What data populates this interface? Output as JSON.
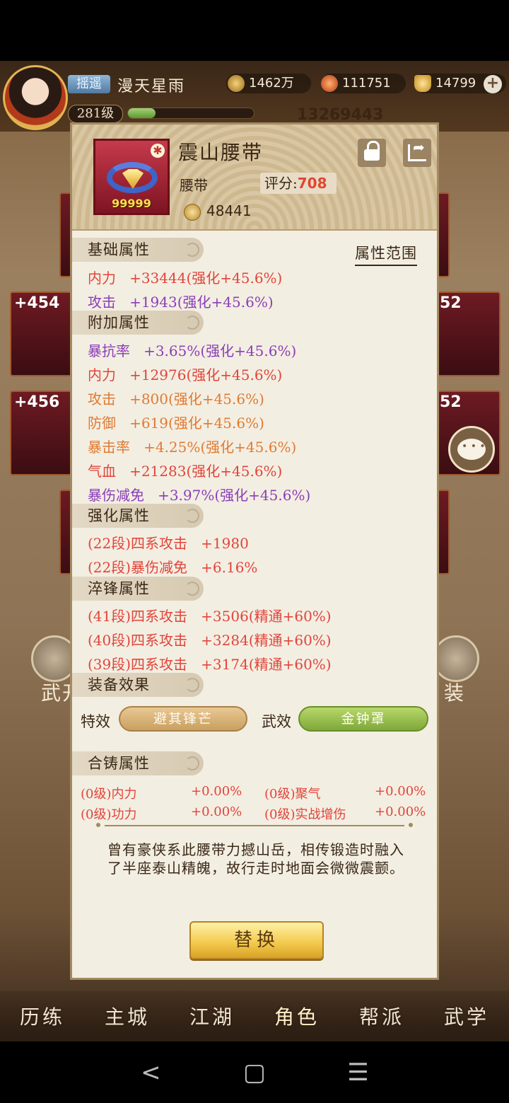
{
  "hud": {
    "title_badge": "摇遥",
    "player_name": "漫天星雨",
    "level": "281级",
    "exp_fraction": 0.22,
    "resources": {
      "coins": "1462万",
      "spirit": "111751",
      "gold": "14799"
    },
    "power": "13269443"
  },
  "background": {
    "slots": [
      "+454",
      "+456",
      "52",
      "52"
    ],
    "tabs": [
      "武开",
      "装"
    ]
  },
  "bottom_menu": [
    "历练",
    "主城",
    "江湖",
    "角色",
    "帮派",
    "武学"
  ],
  "nav_bar": {
    "back": "<",
    "home": "▢",
    "recents": "☰"
  },
  "item": {
    "name": "震山腰带",
    "type": "腰带",
    "score_label": "评分:",
    "score": "708",
    "quantity": "99999",
    "power": "48441"
  },
  "sections": {
    "base": "基础属性",
    "range_link": "属性范围",
    "extra": "附加属性",
    "enhance": "强化属性",
    "temper": "淬锋属性",
    "effects": "装备效果",
    "casting": "合铸属性"
  },
  "base_stats": [
    {
      "name": "内力",
      "value": "+33444(强化+45.6%)"
    },
    {
      "name": "攻击",
      "value": "+1943(强化+45.6%)"
    }
  ],
  "extra_stats": [
    {
      "name": "暴抗率",
      "value": "+3.65%(强化+45.6%)"
    },
    {
      "name": "内力",
      "value": "+12976(强化+45.6%)"
    },
    {
      "name": "攻击",
      "value": "+800(强化+45.6%)"
    },
    {
      "name": "防御",
      "value": "+619(强化+45.6%)"
    },
    {
      "name": "暴击率",
      "value": "+4.25%(强化+45.6%)"
    },
    {
      "name": "气血",
      "value": "+21283(强化+45.6%)"
    },
    {
      "name": "暴伤减免",
      "value": "+3.97%(强化+45.6%)"
    }
  ],
  "enhance_stats": [
    {
      "name": "(22段)四系攻击",
      "value": "+1980"
    },
    {
      "name": "(22段)暴伤减免",
      "value": "+6.16%"
    }
  ],
  "temper_stats": [
    {
      "name": "(41段)四系攻击",
      "value": "+3506(精通+60%)"
    },
    {
      "name": "(40段)四系攻击",
      "value": "+3284(精通+60%)"
    },
    {
      "name": "(39段)四系攻击",
      "value": "+3174(精通+60%)"
    }
  ],
  "effects": {
    "special_label": "特效",
    "special_value": "避其锋芒",
    "martial_label": "武效",
    "martial_value": "金钟罩"
  },
  "casting_stats": [
    {
      "name": "(0级)内力",
      "value": "+0.00%"
    },
    {
      "name": "(0级)聚气",
      "value": "+0.00%"
    },
    {
      "name": "(0级)功力",
      "value": "+0.00%"
    },
    {
      "name": "(0级)实战增伤",
      "value": "+0.00%"
    }
  ],
  "description": "曾有豪侠系此腰带力撼山岳，相传锻造时融入了半座泰山精魄，故行走时地面会微微震颤。",
  "replace_button": "替换",
  "colors": {
    "stat_red": "#e2443a",
    "stat_purple": "#8a3eb8",
    "stat_orange": "#e07a32",
    "score": "#e04632"
  }
}
